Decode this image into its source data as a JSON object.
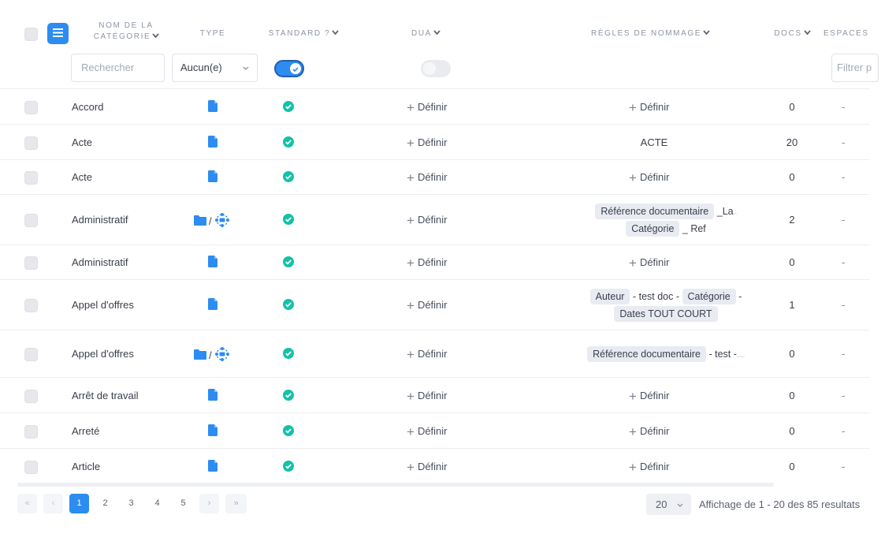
{
  "header": {
    "col_name": "NOM DE LA CATÉGORIE",
    "col_name_l1": "NOM DE LA",
    "col_name_l2": "CATÉGORIE",
    "col_type": "TYPE",
    "col_standard": "STANDARD ?",
    "col_dua": "DUA",
    "col_rules": "RÈGLES DE NOMMAGE",
    "col_docs": "DOCS",
    "col_spaces": "ESPACES"
  },
  "filters": {
    "search_placeholder": "Rechercher",
    "type_select": "Aucun(e)",
    "standard_toggle": "on",
    "dua_toggle": "off",
    "spaces_placeholder": "Filtrer p"
  },
  "define_label": "Définir",
  "rows": [
    {
      "name": "Accord",
      "type": "file",
      "standard": true,
      "dua": "Définir",
      "rule": "Définir",
      "docs": "0",
      "spaces": "-"
    },
    {
      "name": "Acte",
      "type": "file",
      "standard": true,
      "dua": "Définir",
      "rule": "ACTE",
      "docs": "20",
      "spaces": "-"
    },
    {
      "name": "Acte",
      "type": "file",
      "standard": true,
      "dua": "Définir",
      "rule": "Définir",
      "docs": "0",
      "spaces": "-"
    },
    {
      "name": "Administratif",
      "type": "folder",
      "standard": true,
      "dua": "Définir",
      "rule_tags": [
        "Référence documentaire",
        "_La",
        "Catégorie",
        "_ Ref"
      ],
      "docs": "2",
      "spaces": "-"
    },
    {
      "name": "Administratif",
      "type": "file",
      "standard": true,
      "dua": "Définir",
      "rule": "Définir",
      "docs": "0",
      "spaces": "-"
    },
    {
      "name": "Appel d'offres",
      "type": "file",
      "standard": true,
      "dua": "Définir",
      "rule_tags": [
        "Auteur",
        "- test doc -",
        "Catégorie",
        "-",
        "Dates TOUT COURT"
      ],
      "docs": "1",
      "spaces": "-"
    },
    {
      "name": "Appel d'offres",
      "type": "folder",
      "standard": true,
      "dua": "Définir",
      "rule_tags": [
        "Référence documentaire",
        "- test -",
        ""
      ],
      "docs": "0",
      "spaces": "-"
    },
    {
      "name": "Arrêt de travail",
      "type": "file",
      "standard": true,
      "dua": "Définir",
      "rule": "Définir",
      "docs": "0",
      "spaces": "-"
    },
    {
      "name": "Arreté",
      "type": "file",
      "standard": true,
      "dua": "Définir",
      "rule": "Définir",
      "docs": "0",
      "spaces": "-"
    },
    {
      "name": "Article",
      "type": "file",
      "standard": true,
      "dua": "Définir",
      "rule": "Définir",
      "docs": "0",
      "spaces": "-"
    }
  ],
  "pagination": {
    "first": "«",
    "prev": "‹",
    "pages": [
      "1",
      "2",
      "3",
      "4",
      "5"
    ],
    "next": "›",
    "last": "»",
    "current": "1",
    "per_page": "20",
    "info": "Affichage de 1 - 20 des 85 resultats"
  },
  "colors": {
    "accent": "#2d8cf0",
    "check": "#13c2a8",
    "tag_bg": "#e8ebf1"
  }
}
